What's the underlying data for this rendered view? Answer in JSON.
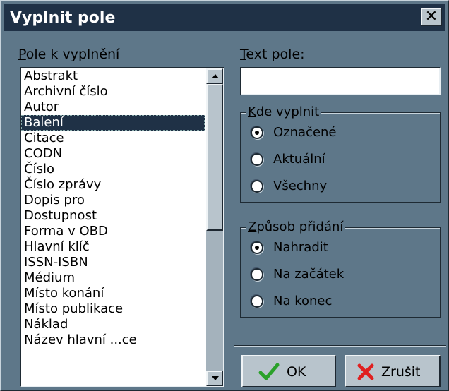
{
  "window": {
    "title": "Vyplnit pole",
    "close_glyph": "✕"
  },
  "left": {
    "label_prefix": "P",
    "label_rest": "ole k vyplnění",
    "items": [
      "Abstrakt",
      "Archivní číslo",
      "Autor",
      "Balení",
      "Citace",
      "CODN",
      "Číslo",
      "Číslo zprávy",
      "Dopis pro",
      "Dostupnost",
      "Forma v OBD",
      "Hlavní klíč",
      "ISSN-ISBN",
      "Médium",
      "Místo konání",
      "Místo publikace",
      "Náklad",
      "Název hlavní ...ce"
    ],
    "selected_index": 3
  },
  "right": {
    "text_label_prefix": "T",
    "text_label_rest": "ext pole:",
    "text_value": "",
    "where_group": {
      "legend_prefix": "K",
      "legend_rest": "de vyplnit",
      "options": [
        "Označené",
        "Aktuální",
        "Všechny"
      ],
      "selected_index": 0
    },
    "mode_group": {
      "legend_prefix": "Z",
      "legend_rest": "působ přidání",
      "options": [
        "Nahradit",
        "Na začátek",
        "Na konec"
      ],
      "selected_index": 0
    }
  },
  "buttons": {
    "ok_label": "OK",
    "cancel_label": "Zrušit"
  },
  "colors": {
    "titlebar": "#1f3146",
    "face": "#5e7789",
    "ok_check": "#2aa12a",
    "cancel_x": "#e02020"
  },
  "icons": {
    "ok": "check-icon",
    "cancel": "x-icon"
  }
}
